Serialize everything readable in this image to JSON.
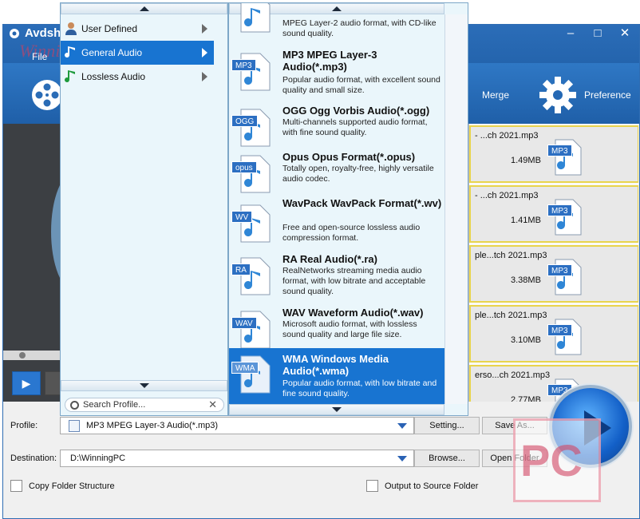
{
  "app": {
    "title": "Avdsh",
    "watermark": "WinningPC",
    "menu_file": "File",
    "window_buttons": [
      "–",
      "□",
      "✕"
    ],
    "toolbar": {
      "merge_label": "Merge",
      "preference_label": "Preference"
    }
  },
  "file_list": [
    {
      "name": "- ...ch 2021.mp3",
      "size": "1.49MB",
      "badge": "MP3"
    },
    {
      "name": "- ...ch 2021.mp3",
      "size": "1.41MB",
      "badge": "MP3"
    },
    {
      "name": "ple...tch 2021.mp3",
      "size": "3.38MB",
      "badge": "MP3"
    },
    {
      "name": "ple...tch 2021.mp3",
      "size": "3.10MB",
      "badge": "MP3"
    },
    {
      "name": "erso...ch 2021.mp3",
      "size": "2.77MB",
      "badge": "MP3"
    }
  ],
  "bottom": {
    "profile_label": "Profile:",
    "profile_value": "MP3 MPEG Layer-3 Audio(*.mp3)",
    "setting_label": "Setting...",
    "save_as_label": "Save As...",
    "destination_label": "Destination:",
    "destination_value": "D:\\WinningPC",
    "browse_label": "Browse...",
    "open_folder_label": "Open Folder",
    "copy_folder_label": "Copy Folder Structure",
    "output_source_label": "Output to Source Folder",
    "pc_mark": "PC"
  },
  "categories": [
    {
      "label": "User Defined",
      "icon": "user-icon"
    },
    {
      "label": "General Audio",
      "icon": "audio-icon",
      "selected": true
    },
    {
      "label": "Lossless Audio",
      "icon": "music-note-icon"
    }
  ],
  "search_placeholder": "Search Profile...",
  "formats": [
    {
      "badge": "",
      "title": "",
      "desc": "MPEG Layer-2 audio format, with CD-like sound quality."
    },
    {
      "badge": "MP3",
      "title": "MP3 MPEG Layer-3 Audio(*.mp3)",
      "desc": "Popular audio format, with excellent sound quality and small size."
    },
    {
      "badge": "OGG",
      "title": "OGG Ogg Vorbis Audio(*.ogg)",
      "desc": "Multi-channels supported audio format, with fine sound quality."
    },
    {
      "badge": "opus",
      "title": "Opus Opus Format(*.opus)",
      "desc": "Totally open, royalty-free, highly versatile audio codec."
    },
    {
      "badge": "WV",
      "title": "WavPack WavPack Format(*.wv)",
      "desc": "Free and open-source lossless audio compression format."
    },
    {
      "badge": "RA",
      "title": "RA Real Audio(*.ra)",
      "desc": "RealNetworks streaming media audio format, with low bitrate and acceptable sound quality."
    },
    {
      "badge": "WAV",
      "title": "WAV Waveform Audio(*.wav)",
      "desc": "Microsoft audio format, with lossless sound quality and large file size."
    },
    {
      "badge": "WMA",
      "title": "WMA Windows Media Audio(*.wma)",
      "desc": "Popular audio format, with low bitrate and fine sound quality.",
      "selected": true
    }
  ],
  "colors": {
    "accent": "#1874d1",
    "menu_bg": "#eaf6fb",
    "title_bar": "#2464ad"
  }
}
